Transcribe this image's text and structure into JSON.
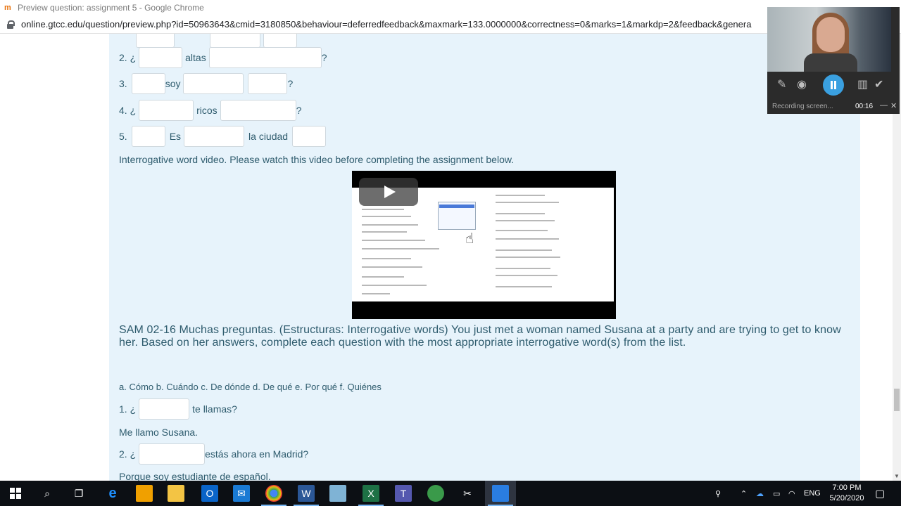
{
  "browser": {
    "window_title": "Preview question: assignment 5 - Google Chrome",
    "url": "online.gtcc.edu/question/preview.php?id=50963643&cmid=3180850&behaviour=deferredfeedback&maxmark=133.0000000&correctness=0&marks=1&markdp=2&feedback&genera"
  },
  "questions_top": [
    {
      "num": "2. ¿",
      "word1": "altas",
      "end": "?"
    },
    {
      "num": "3.",
      "word1": "soy",
      "end": "?"
    },
    {
      "num": "4. ¿",
      "word1": "ricos",
      "end": "?"
    },
    {
      "num": "5.",
      "word1": "Es",
      "word2": "la ciudad"
    }
  ],
  "intro_text": "Interrogative word video. Please watch this video before completing the assignment below.",
  "heading": "SAM 02-16 Muchas preguntas. (Estructuras: Interrogative words) You just met a woman named Susana at a party and are trying to get to know her. Based on her answers, complete each question with the most appropriate interrogative word(s) from the list.",
  "options_line": "a. Cómo b. Cuándo c. De dónde d. De qué e. Por qué f. Quiénes",
  "q1": {
    "prefix": "1. ¿",
    "suffix": "te llamas?",
    "answer": "Me llamo Susana."
  },
  "q2": {
    "prefix": "2. ¿",
    "suffix": "estás ahora en Madrid?",
    "answer": "Porque soy estudiante de español."
  },
  "recorder": {
    "status": "Recording screen...",
    "timer": "00:16"
  },
  "taskbar": {
    "lang": "ENG",
    "time": "7:00 PM",
    "date": "5/20/2020",
    "apps": [
      "start-icon",
      "search-icon",
      "task-view-icon",
      "edge-icon",
      "store-icon",
      "file-explorer-icon",
      "outlook-icon",
      "mail-icon",
      "chrome-icon",
      "word-icon",
      "notepad-icon",
      "excel-icon",
      "teams-icon",
      "globe-icon",
      "snip-icon",
      "recorder-app-icon"
    ]
  },
  "colors": {
    "page_bg": "#e7f3fb",
    "text": "#2f5c6e",
    "taskbar": "#0c0f14",
    "accent": "#3aa0e0"
  }
}
